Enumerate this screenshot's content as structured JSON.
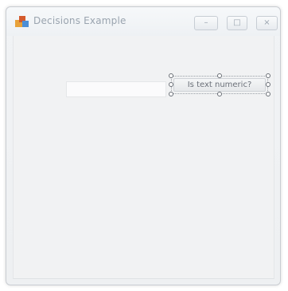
{
  "window": {
    "title": "Decisions Example",
    "controls": {
      "minimize": "–",
      "maximize": "□",
      "close": "×"
    }
  },
  "form": {
    "textbox_value": "",
    "button_label": "Is text numeric?"
  }
}
